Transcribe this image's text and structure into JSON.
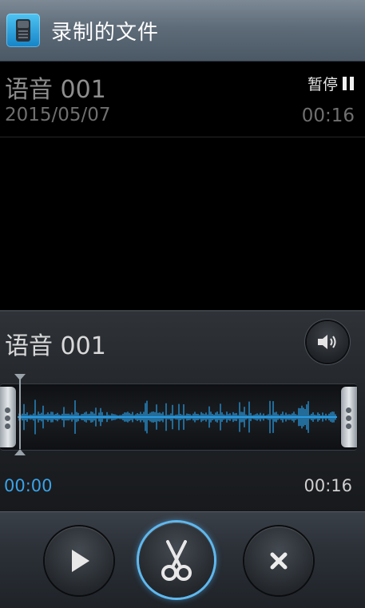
{
  "header": {
    "title": "录制的文件",
    "icon": "recorder-app-icon"
  },
  "file_item": {
    "name": "语音 001",
    "date": "2015/05/07",
    "status_label": "暂停",
    "status_icon": "pause-icon",
    "duration": "00:16"
  },
  "player": {
    "title": "语音 001",
    "speaker_icon": "speaker-icon",
    "current_time": "00:00",
    "total_time": "00:16",
    "progress": 0.0
  },
  "controls": {
    "play_icon": "play-icon",
    "trim_icon": "scissors-icon",
    "cancel_icon": "close-icon"
  },
  "colors": {
    "accent": "#3aa3e8",
    "waveform": "#2a9be0",
    "title_bar": "#5e6b78"
  }
}
